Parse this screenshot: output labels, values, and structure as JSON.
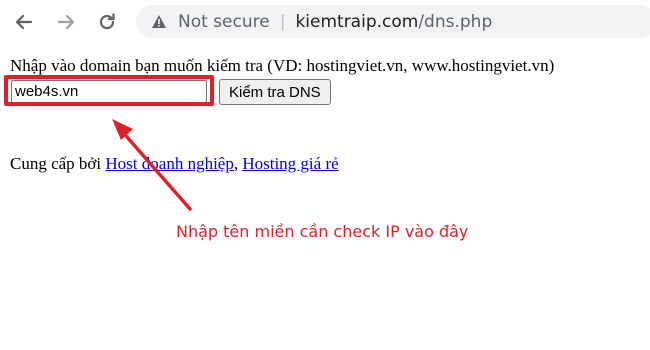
{
  "browser": {
    "back_icon": "arrow-left-icon",
    "forward_icon": "arrow-right-icon",
    "reload_icon": "reload-icon",
    "security_icon": "warning-triangle-icon",
    "security_status": "Not secure",
    "separator": "|",
    "url_domain": "kiemtraip.com",
    "url_path": "/dns.php"
  },
  "page": {
    "prompt": "Nhập vào domain bạn muốn kiểm tra (VD: hostingviet.vn, www.hostingviet.vn)",
    "input_value": "web4s.vn",
    "submit_label": "Kiểm tra DNS",
    "provided_by": "Cung cấp bởi",
    "link1": "Host doanh nghiệp",
    "comma": ",",
    "link2": "Hosting giá rẻ"
  },
  "annotation": {
    "text": "Nhập tên miền cần check IP vào đây",
    "color": "#e02027"
  }
}
